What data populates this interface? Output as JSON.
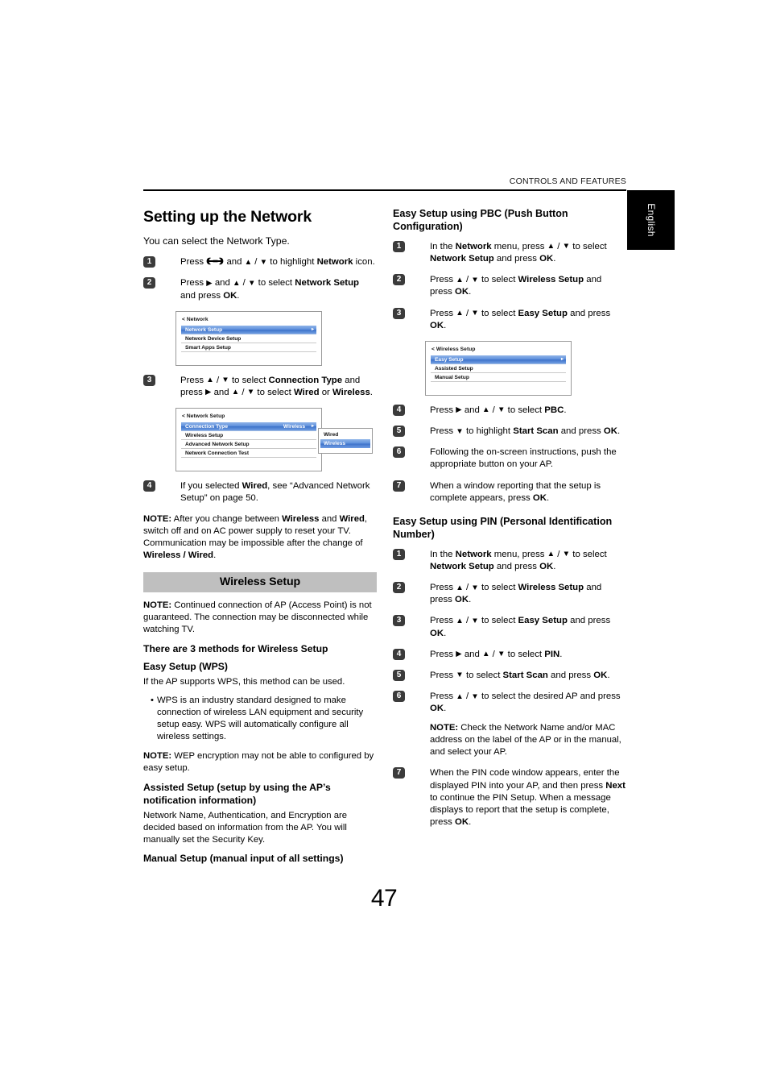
{
  "header": {
    "running_head": "CONTROLS AND FEATURES",
    "language_tab": "English"
  },
  "folio": "47",
  "left_column": {
    "title": "Setting up the Network",
    "lead": "You can select the Network Type.",
    "steps": [
      {
        "num": "1",
        "parts": [
          {
            "t": "Press "
          },
          {
            "icon": "wrench-icon"
          },
          {
            "t": " and "
          },
          {
            "arrow": "up"
          },
          {
            "t": " / "
          },
          {
            "arrow": "down"
          },
          {
            "t": " to highlight "
          },
          {
            "b": "Network"
          },
          {
            "t": " icon."
          }
        ]
      },
      {
        "num": "2",
        "parts": [
          {
            "t": "Press "
          },
          {
            "arrow": "right"
          },
          {
            "t": " and "
          },
          {
            "arrow": "up"
          },
          {
            "t": " / "
          },
          {
            "arrow": "down"
          },
          {
            "t": " to select "
          },
          {
            "b": "Network Setup"
          },
          {
            "t": " and press "
          },
          {
            "b": "OK"
          },
          {
            "t": "."
          }
        ]
      },
      {
        "num": "3",
        "parts": [
          {
            "t": "Press "
          },
          {
            "arrow": "up"
          },
          {
            "t": " / "
          },
          {
            "arrow": "down"
          },
          {
            "t": " to select "
          },
          {
            "b": "Connection Type"
          },
          {
            "t": " and press "
          },
          {
            "arrow": "right"
          },
          {
            "t": " and "
          },
          {
            "arrow": "up"
          },
          {
            "t": " / "
          },
          {
            "arrow": "down"
          },
          {
            "t": " to select "
          },
          {
            "b": "Wired"
          },
          {
            "t": " or "
          },
          {
            "b": "Wireless"
          },
          {
            "t": "."
          }
        ]
      },
      {
        "num": "4",
        "parts": [
          {
            "t": "If you selected "
          },
          {
            "b": "Wired"
          },
          {
            "t": ", see “Advanced Network Setup” on page 50."
          }
        ]
      }
    ],
    "menu_network": {
      "breadcrumb": "< Network",
      "rows": [
        {
          "label": "Network Setup",
          "selected": true,
          "caret": "▸"
        },
        {
          "label": "Network Device Setup",
          "selected": false
        },
        {
          "label": "Smart Apps Setup",
          "selected": false
        }
      ]
    },
    "menu_network_setup": {
      "breadcrumb": "< Network Setup",
      "rows": [
        {
          "label": "Connection Type",
          "value": "Wireless",
          "selected": true,
          "caret": "▸"
        },
        {
          "label": "Wireless Setup",
          "selected": false
        },
        {
          "label": "Advanced Network Setup",
          "selected": false
        },
        {
          "label": "Network Connection Test",
          "selected": false
        }
      ],
      "popup_rows": [
        {
          "label": "Wired",
          "selected": false
        },
        {
          "label": "Wireless",
          "selected": true
        }
      ]
    },
    "note_change": {
      "label": "NOTE:",
      "parts": [
        {
          "t": "  After you change between "
        },
        {
          "b": "Wireless"
        },
        {
          "t": " and "
        },
        {
          "b": "Wired"
        },
        {
          "t": ", switch off and on AC power supply to reset your TV. Communication may be impossible after the change of "
        },
        {
          "b": "Wireless / Wired"
        },
        {
          "t": "."
        }
      ]
    },
    "band": "Wireless Setup",
    "note_ap": {
      "label": "NOTE:",
      "text": " Continued connection of AP (Access Point) is not guaranteed. The connection may be disconnected while watching TV."
    },
    "methods_heading": "There are 3 methods for Wireless Setup",
    "easy_setup_wps": {
      "heading": "Easy Setup (WPS)",
      "text": "If the AP supports WPS, this method can be used.",
      "bullets": [
        "WPS is an industry standard designed to make connection of wireless LAN equipment and security setup easy. WPS will automatically configure all wireless settings."
      ]
    },
    "note_wep": {
      "label": "NOTE:",
      "text": "  WEP encryption may not be able to configured by easy setup."
    },
    "assisted_setup": {
      "heading": "Assisted Setup (setup by using the AP’s notification information)",
      "text": "Network Name, Authentication, and Encryption are decided based on information from the AP. You will manually set the Security Key."
    },
    "manual_setup": {
      "heading": "Manual Setup (manual input of all settings)"
    }
  },
  "right_column": {
    "pbc": {
      "heading": "Easy Setup using PBC (Push Button Configuration)",
      "steps": [
        {
          "num": "1",
          "parts": [
            {
              "t": "In the "
            },
            {
              "b": "Network"
            },
            {
              "t": " menu, press "
            },
            {
              "arrow": "up"
            },
            {
              "t": " / "
            },
            {
              "arrow": "down"
            },
            {
              "t": " to select "
            },
            {
              "b": "Network Setup"
            },
            {
              "t": " and press "
            },
            {
              "b": "OK"
            },
            {
              "t": "."
            }
          ]
        },
        {
          "num": "2",
          "parts": [
            {
              "t": "Press "
            },
            {
              "arrow": "up"
            },
            {
              "t": " / "
            },
            {
              "arrow": "down"
            },
            {
              "t": " to select "
            },
            {
              "b": "Wireless Setup"
            },
            {
              "t": " and press "
            },
            {
              "b": "OK"
            },
            {
              "t": "."
            }
          ]
        },
        {
          "num": "3",
          "parts": [
            {
              "t": "Press "
            },
            {
              "arrow": "up"
            },
            {
              "t": " / "
            },
            {
              "arrow": "down"
            },
            {
              "t": " to select "
            },
            {
              "b": "Easy Setup"
            },
            {
              "t": " and press "
            },
            {
              "b": "OK"
            },
            {
              "t": "."
            }
          ]
        },
        {
          "num": "4",
          "parts": [
            {
              "t": "Press "
            },
            {
              "arrow": "right"
            },
            {
              "t": " and "
            },
            {
              "arrow": "up"
            },
            {
              "t": " / "
            },
            {
              "arrow": "down"
            },
            {
              "t": " to select "
            },
            {
              "b": "PBC"
            },
            {
              "t": "."
            }
          ]
        },
        {
          "num": "5",
          "parts": [
            {
              "t": "Press "
            },
            {
              "arrow": "down"
            },
            {
              "t": " to highlight "
            },
            {
              "b": "Start Scan"
            },
            {
              "t": " and press "
            },
            {
              "b": "OK"
            },
            {
              "t": "."
            }
          ]
        },
        {
          "num": "6",
          "parts": [
            {
              "t": "Following the on-screen instructions, push the appropriate button on your AP."
            }
          ]
        },
        {
          "num": "7",
          "parts": [
            {
              "t": "When a window reporting that the setup is complete appears, press "
            },
            {
              "b": "OK"
            },
            {
              "t": "."
            }
          ]
        }
      ]
    },
    "menu_wireless_setup": {
      "breadcrumb": "< Wireless Setup",
      "rows": [
        {
          "label": "Easy Setup",
          "selected": true,
          "caret": "▸"
        },
        {
          "label": "Assisted Setup",
          "selected": false
        },
        {
          "label": "Manual Setup",
          "selected": false
        }
      ]
    },
    "pin": {
      "heading": "Easy Setup using PIN (Personal Identification Number)",
      "steps": [
        {
          "num": "1",
          "parts": [
            {
              "t": "In the "
            },
            {
              "b": "Network"
            },
            {
              "t": " menu, press "
            },
            {
              "arrow": "up"
            },
            {
              "t": " / "
            },
            {
              "arrow": "down"
            },
            {
              "t": " to select "
            },
            {
              "b": "Network Setup"
            },
            {
              "t": " and press "
            },
            {
              "b": "OK"
            },
            {
              "t": "."
            }
          ]
        },
        {
          "num": "2",
          "parts": [
            {
              "t": "Press "
            },
            {
              "arrow": "up"
            },
            {
              "t": " / "
            },
            {
              "arrow": "down"
            },
            {
              "t": " to select "
            },
            {
              "b": "Wireless Setup"
            },
            {
              "t": " and press "
            },
            {
              "b": "OK"
            },
            {
              "t": "."
            }
          ]
        },
        {
          "num": "3",
          "parts": [
            {
              "t": "Press "
            },
            {
              "arrow": "up"
            },
            {
              "t": " / "
            },
            {
              "arrow": "down"
            },
            {
              "t": " to select "
            },
            {
              "b": "Easy Setup"
            },
            {
              "t": " and press "
            },
            {
              "b": "OK"
            },
            {
              "t": "."
            }
          ]
        },
        {
          "num": "4",
          "parts": [
            {
              "t": "Press "
            },
            {
              "arrow": "right"
            },
            {
              "t": " and "
            },
            {
              "arrow": "up"
            },
            {
              "t": " / "
            },
            {
              "arrow": "down"
            },
            {
              "t": " to select "
            },
            {
              "b": "PIN"
            },
            {
              "t": "."
            }
          ]
        },
        {
          "num": "5",
          "parts": [
            {
              "t": "Press "
            },
            {
              "arrow": "down"
            },
            {
              "t": " to select "
            },
            {
              "b": "Start Scan"
            },
            {
              "t": " and press "
            },
            {
              "b": "OK"
            },
            {
              "t": "."
            }
          ]
        },
        {
          "num": "6",
          "parts": [
            {
              "t": "Press "
            },
            {
              "arrow": "up"
            },
            {
              "t": " / "
            },
            {
              "arrow": "down"
            },
            {
              "t": " to select the desired AP and press "
            },
            {
              "b": "OK"
            },
            {
              "t": "."
            }
          ],
          "note": {
            "label": "NOTE:",
            "text": " Check the Network Name and/or MAC address on the label of the AP or in the manual, and select your AP."
          }
        },
        {
          "num": "7",
          "parts": [
            {
              "t": "When the PIN code window appears, enter the displayed PIN into your AP, and then press "
            },
            {
              "b": "Next"
            },
            {
              "t": " to continue the PIN Setup. When a message displays to report that the setup is complete, press "
            },
            {
              "b": "OK"
            },
            {
              "t": "."
            }
          ]
        }
      ]
    }
  }
}
